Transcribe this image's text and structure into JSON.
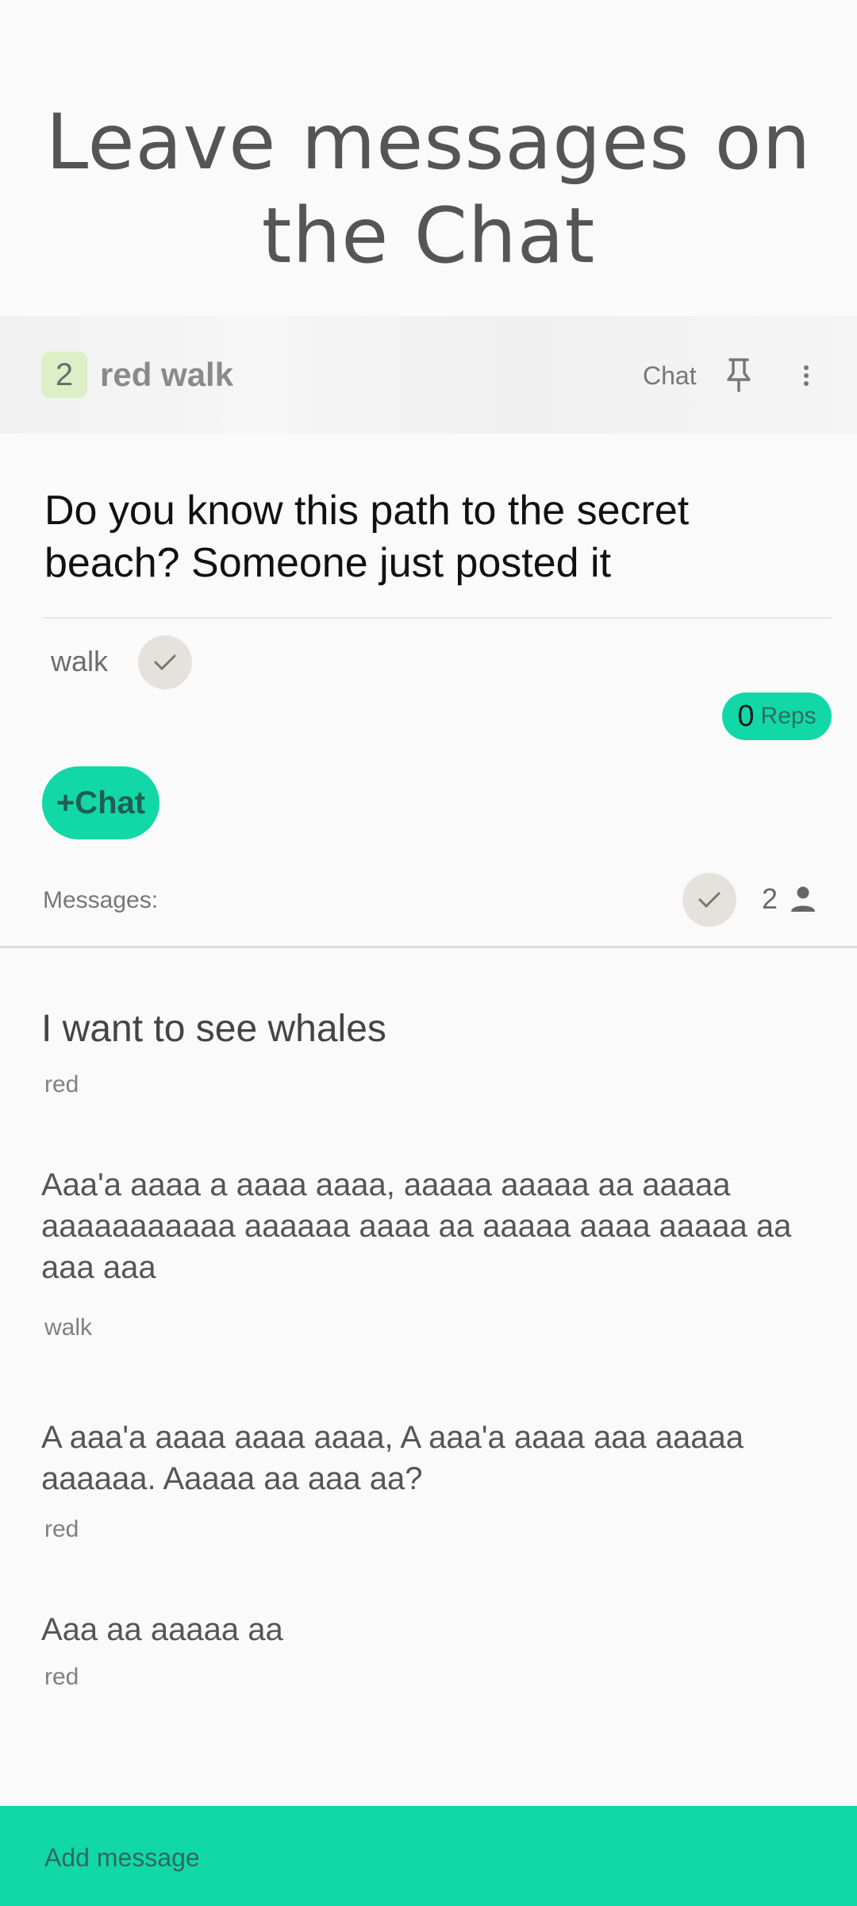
{
  "banner": {
    "line1": "Leave messages on",
    "line2": "the Chat"
  },
  "header": {
    "count": "2",
    "title": "red walk",
    "chat_label": "Chat",
    "icons": [
      "pin-icon",
      "more-vert-icon"
    ]
  },
  "question": "Do you know this path to the secret beach? Someone just posted it",
  "tag": "walk",
  "reps": {
    "count": "0",
    "label": "Reps"
  },
  "add_chat_label": "+Chat",
  "messages_section": {
    "label": "Messages:",
    "participants": "2"
  },
  "messages": [
    {
      "text": "I want to see whales",
      "author": "red"
    },
    {
      "text": "Aaa'a aaaa a aaaa aaaa, aaaaa aaaaa aa aaaaa aaaaaaaaaaa aaaaaa aaaa aa aaaaa aaaa aaaaa aa aaa aaa",
      "author": "walk"
    },
    {
      "text": "A aaa'a aaaa aaaa aaaa, A aaa'a aaaa aaa aaaaa aaaaaa. Aaaaa aa aaa aa?",
      "author": "red"
    },
    {
      "text": "Aaa aa aaaaa aa",
      "author": "red"
    }
  ],
  "input": {
    "placeholder": "Add message"
  },
  "colors": {
    "accent": "#12d8a8",
    "badge": "#dcefc7",
    "check_bg": "#e5e2dd"
  }
}
